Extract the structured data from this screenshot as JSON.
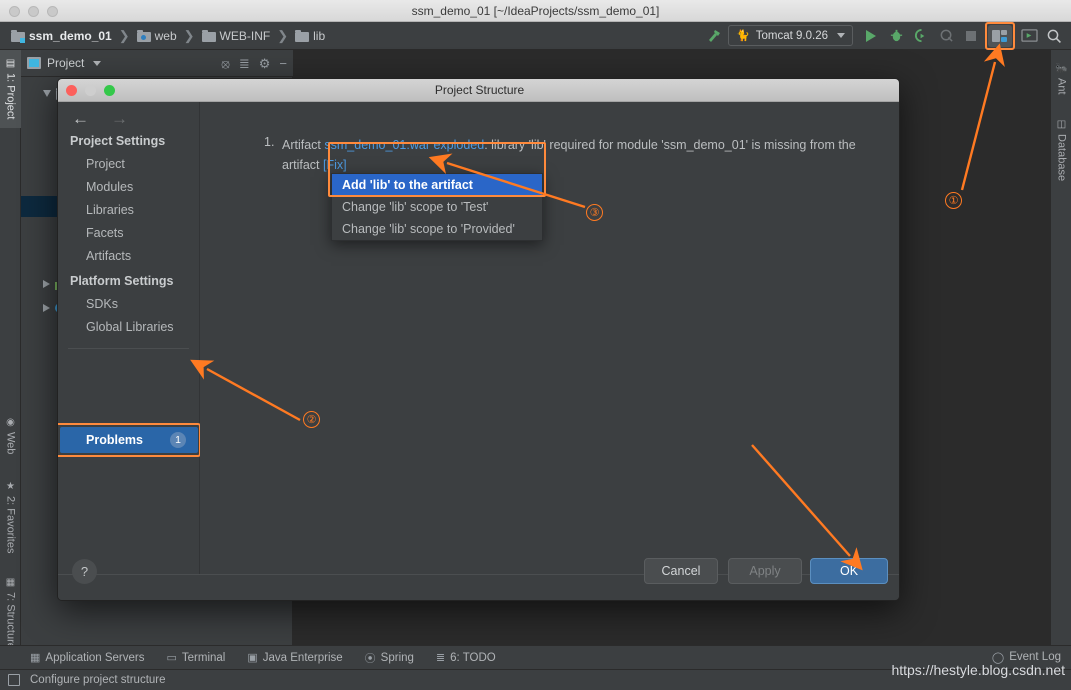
{
  "window": {
    "mac_title": "ssm_demo_01 [~/IdeaProjects/ssm_demo_01]"
  },
  "navbar": {
    "breadcrumbs": [
      {
        "label": "ssm_demo_01",
        "icon": "module-folder-icon"
      },
      {
        "label": "web",
        "icon": "web-folder-icon"
      },
      {
        "label": "WEB-INF",
        "icon": "folder-icon"
      },
      {
        "label": "lib",
        "icon": "folder-icon"
      }
    ],
    "run_config": "Tomcat 9.0.26",
    "buttons": {
      "run": "run-icon",
      "debug": "debug-icon",
      "run_coverage": "run-with-coverage-icon",
      "profile": "profile-icon",
      "stop": "stop-icon",
      "project_structure": "project-structure-icon",
      "updating_app": "update-app-icon",
      "search": "search-everywhere-icon"
    }
  },
  "left_strip": {
    "tabs": [
      {
        "label": "1: Project",
        "icon": "project-icon",
        "active": true
      },
      {
        "label": "Web",
        "icon": "web-icon",
        "active": false
      },
      {
        "label": "2: Favorites",
        "icon": "star-icon",
        "active": false
      },
      {
        "label": "7: Structure",
        "icon": "structure-icon",
        "active": false
      }
    ]
  },
  "right_strip": {
    "tabs": [
      {
        "label": "Ant",
        "icon": "ant-icon"
      },
      {
        "label": "Database",
        "icon": "database-icon"
      }
    ]
  },
  "project_panel": {
    "title": "Project",
    "header_icons": [
      "locate-icon",
      "collapse-all-icon",
      "gear-icon",
      "minimize-icon"
    ]
  },
  "dialog": {
    "title": "Project Structure",
    "nav": {
      "back": "←",
      "forward": "→"
    },
    "sidebar": {
      "groups": [
        {
          "title": "Project Settings",
          "items": [
            "Project",
            "Modules",
            "Libraries",
            "Facets",
            "Artifacts"
          ]
        },
        {
          "title": "Platform Settings",
          "items": [
            "SDKs",
            "Global Libraries"
          ]
        }
      ],
      "problems": {
        "label": "Problems",
        "badge": "1"
      }
    },
    "problem": {
      "number": "1.",
      "prefix": "Artifact ",
      "artifact_link": "ssm_demo_01:war exploded",
      "suffix": ": library 'lib' required for module 'ssm_demo_01' is missing from the artifact ",
      "fix_link": "[Fix]"
    },
    "context_menu": {
      "items": [
        {
          "label": "Add 'lib' to the artifact",
          "selected": true
        },
        {
          "label": "Change 'lib' scope to 'Test'",
          "selected": false
        },
        {
          "label": "Change 'lib' scope to 'Provided'",
          "selected": false
        }
      ]
    },
    "footer": {
      "help": "?",
      "cancel": "Cancel",
      "apply": "Apply",
      "ok": "OK"
    }
  },
  "bottom_strip": {
    "items": [
      {
        "label": "Application Servers",
        "icon": "app-servers-icon"
      },
      {
        "label": "Terminal",
        "icon": "terminal-icon"
      },
      {
        "label": "Java Enterprise",
        "icon": "java-enterprise-icon"
      },
      {
        "label": "Spring",
        "icon": "spring-icon"
      },
      {
        "label": "6: TODO",
        "icon": "todo-icon"
      }
    ],
    "event_log": "Event Log"
  },
  "statusbar": {
    "message": "Configure project structure"
  },
  "watermark": "https://hestyle.blog.csdn.net",
  "annotations": {
    "markers": [
      {
        "label": "①"
      },
      {
        "label": "②"
      },
      {
        "label": "③"
      }
    ]
  },
  "colors": {
    "accent_orange": "#ff7a22",
    "selection_blue": "#2a66c8",
    "link_blue": "#4d9ae0",
    "bg_panel": "#3c3f41",
    "bg_editor": "#2b2b2b"
  }
}
